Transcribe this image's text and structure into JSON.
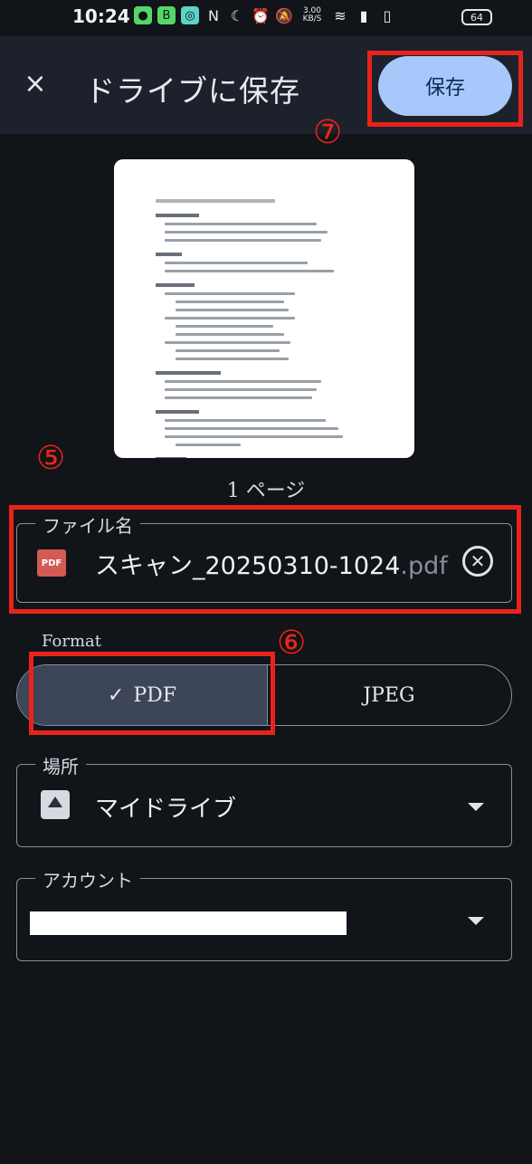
{
  "status_bar": {
    "time": "10:24",
    "net_speed_top": "3.00",
    "net_speed_bottom": "KB/S",
    "battery": "64"
  },
  "app_bar": {
    "close_icon": "×",
    "title": "ドライブに保存",
    "save_label": "保存"
  },
  "markers": {
    "m5": "⑤",
    "m6": "⑥",
    "m7": "⑦"
  },
  "preview": {
    "page_count": "1 ページ"
  },
  "file_field": {
    "label": "ファイル名",
    "name": "スキャン_20250310-1024",
    "extension": ".pdf",
    "badge": "PDF"
  },
  "format": {
    "label": "Format",
    "options": [
      {
        "label": "PDF",
        "selected": true,
        "check": "✓"
      },
      {
        "label": "JPEG",
        "selected": false
      }
    ]
  },
  "location": {
    "label": "場所",
    "value": "マイドライブ"
  },
  "account": {
    "label": "アカウント"
  },
  "colors": {
    "accent": "#a8c7fa",
    "annotation": "#e8231c",
    "background": "#111419"
  }
}
